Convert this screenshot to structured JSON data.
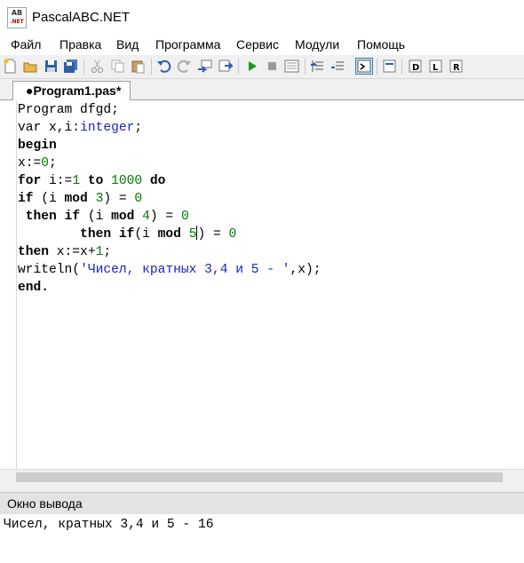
{
  "window": {
    "title": "PascalABC.NET",
    "icon_text_top": "AB",
    "icon_text_bottom": ".NET"
  },
  "menu": [
    "Файл",
    "Правка",
    "Вид",
    "Программа",
    "Сервис",
    "Модули",
    "Помощь"
  ],
  "toolbar": {
    "buttons": [
      "new-file-icon",
      "open-icon",
      "save-icon",
      "save-all-icon",
      "cut-icon",
      "copy-icon",
      "paste-icon",
      "undo-icon",
      "redo-icon",
      "compile-icon",
      "rebuild-icon",
      "run-icon",
      "stop-icon",
      "debug-window-icon",
      "step-into-icon",
      "step-over-icon",
      "output-toggle-icon",
      "form-icon",
      "dll-icon",
      "library-icon",
      "reference-icon"
    ]
  },
  "tab": {
    "label": "●Program1.pas*"
  },
  "editor": {
    "lines": [
      [
        {
          "t": "Program dfgd;",
          "c": ""
        }
      ],
      [
        {
          "t": "var x,i:",
          "c": ""
        },
        {
          "t": "integer",
          "c": "ty"
        },
        {
          "t": ";",
          "c": ""
        }
      ],
      [
        {
          "t": "begin",
          "c": "kw"
        }
      ],
      [
        {
          "t": "x:=",
          "c": ""
        },
        {
          "t": "0",
          "c": "num"
        },
        {
          "t": ";",
          "c": ""
        }
      ],
      [
        {
          "t": "for",
          "c": "kw"
        },
        {
          "t": " i:=",
          "c": ""
        },
        {
          "t": "1",
          "c": "num"
        },
        {
          "t": " ",
          "c": ""
        },
        {
          "t": "to",
          "c": "kw"
        },
        {
          "t": " ",
          "c": ""
        },
        {
          "t": "1000",
          "c": "num"
        },
        {
          "t": " ",
          "c": ""
        },
        {
          "t": "do",
          "c": "kw"
        }
      ],
      [
        {
          "t": "if",
          "c": "kw"
        },
        {
          "t": " (i ",
          "c": ""
        },
        {
          "t": "mod",
          "c": "kw"
        },
        {
          "t": " ",
          "c": ""
        },
        {
          "t": "3",
          "c": "num"
        },
        {
          "t": ") = ",
          "c": ""
        },
        {
          "t": "0",
          "c": "num"
        }
      ],
      [
        {
          "t": " ",
          "c": ""
        },
        {
          "t": "then",
          "c": "kw"
        },
        {
          "t": " ",
          "c": ""
        },
        {
          "t": "if",
          "c": "kw"
        },
        {
          "t": " (i ",
          "c": ""
        },
        {
          "t": "mod",
          "c": "kw"
        },
        {
          "t": " ",
          "c": ""
        },
        {
          "t": "4",
          "c": "num"
        },
        {
          "t": ") = ",
          "c": ""
        },
        {
          "t": "0",
          "c": "num"
        }
      ],
      [
        {
          "t": "        ",
          "c": ""
        },
        {
          "t": "then",
          "c": "kw"
        },
        {
          "t": " ",
          "c": ""
        },
        {
          "t": "if",
          "c": "kw"
        },
        {
          "t": "(i ",
          "c": ""
        },
        {
          "t": "mod",
          "c": "kw"
        },
        {
          "t": " ",
          "c": ""
        },
        {
          "t": "5",
          "c": "num"
        },
        {
          "t": "|",
          "c": "cursor"
        },
        {
          "t": ") = ",
          "c": ""
        },
        {
          "t": "0",
          "c": "num"
        }
      ],
      [
        {
          "t": "then",
          "c": "kw"
        },
        {
          "t": " x:=x+",
          "c": ""
        },
        {
          "t": "1",
          "c": "num"
        },
        {
          "t": ";",
          "c": ""
        }
      ],
      [
        {
          "t": "writeln(",
          "c": ""
        },
        {
          "t": "'Чисел, кратных 3,4 и 5 - '",
          "c": "str"
        },
        {
          "t": ",x);",
          "c": ""
        }
      ],
      [
        {
          "t": "end.",
          "c": "kw"
        }
      ]
    ]
  },
  "output_panel": {
    "title": "Окно вывода",
    "text": "Чисел, кратных 3,4 и 5 - 16"
  }
}
